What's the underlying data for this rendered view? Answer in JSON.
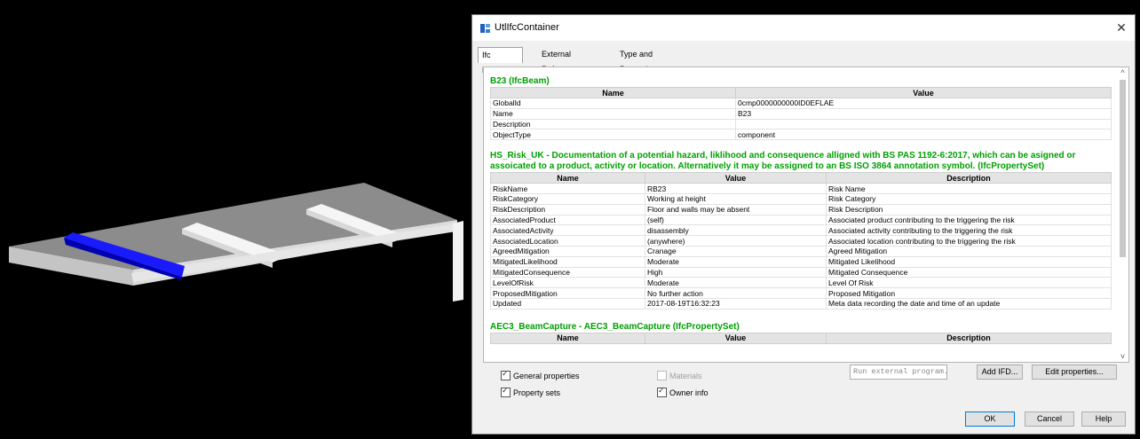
{
  "window": {
    "title": "UtlIfcContainer",
    "close_glyph": "✕"
  },
  "tabs": [
    {
      "label": "Ifc Properties",
      "active": true
    },
    {
      "label": "External References",
      "active": false
    },
    {
      "label": "Type and Properties",
      "active": false
    }
  ],
  "sections": {
    "entity": {
      "title": "B23 (IfcBeam)",
      "headers": [
        "Name",
        "Value"
      ],
      "rows": [
        [
          "GlobalId",
          "0cmp0000000000ID0EFLAE"
        ],
        [
          "Name",
          "B23"
        ],
        [
          "Description",
          ""
        ],
        [
          "ObjectType",
          "component"
        ]
      ]
    },
    "risk": {
      "title": "HS_Risk_UK - Documentation of a potential hazard, liklihood and consequence alligned with BS PAS 1192-6:2017, which can be asigned or assoicated to a product, activity or location. Alternatively it may be assigned to an BS ISO 3864 annotation symbol. (IfcPropertySet)",
      "headers": [
        "Name",
        "Value",
        "Description"
      ],
      "rows": [
        [
          "RiskName",
          "RB23",
          "Risk Name"
        ],
        [
          "RiskCategory",
          "Working at height",
          "Risk Category"
        ],
        [
          "RiskDescription",
          "Floor and walls may be absent",
          "Risk Description"
        ],
        [
          "AssociatedProduct",
          "(self)",
          "Associated product contributing to the triggering the risk"
        ],
        [
          "AssociatedActivity",
          "disassembly",
          "Associated activity contributing to the triggering the risk"
        ],
        [
          "AssociatedLocation",
          "(anywhere)",
          "Associated location contributing to the triggering the risk"
        ],
        [
          "AgreedMitigation",
          "Cranage",
          "Agreed Mitigation"
        ],
        [
          "MitigatedLikelihood",
          "Moderate",
          "Mitigated Likelihood"
        ],
        [
          "MitigatedConsequence",
          "High",
          "Mitigated Consequence"
        ],
        [
          "LevelOfRisk",
          "Moderate",
          "Level Of Risk"
        ],
        [
          "ProposedMitigation",
          "No further action",
          "Proposed Mitigation"
        ],
        [
          "Updated",
          "2017-08-19T16:32:23",
          "Meta data recording the date and time of an update"
        ]
      ]
    },
    "beam_capture": {
      "title": "AEC3_BeamCapture - AEC3_BeamCapture (IfcPropertySet)",
      "headers": [
        "Name",
        "Value",
        "Description"
      ]
    }
  },
  "scrollbar": {
    "up": "^",
    "down": "˅"
  },
  "options": {
    "general_properties": {
      "label": "General properties",
      "checked": true
    },
    "materials": {
      "label": "Materials",
      "checked": false,
      "disabled": true
    },
    "property_sets": {
      "label": "Property sets",
      "checked": true
    },
    "owner_info": {
      "label": "Owner info",
      "checked": true
    }
  },
  "actions": {
    "run_external": "Run external program... ▾",
    "add_ifd": "Add IFD...",
    "edit_properties": "Edit properties..."
  },
  "footer": {
    "ok": "OK",
    "cancel": "Cancel",
    "help": "Help"
  },
  "colors": {
    "highlight_beam": "#1a1aff",
    "section_title": "#00a000"
  }
}
